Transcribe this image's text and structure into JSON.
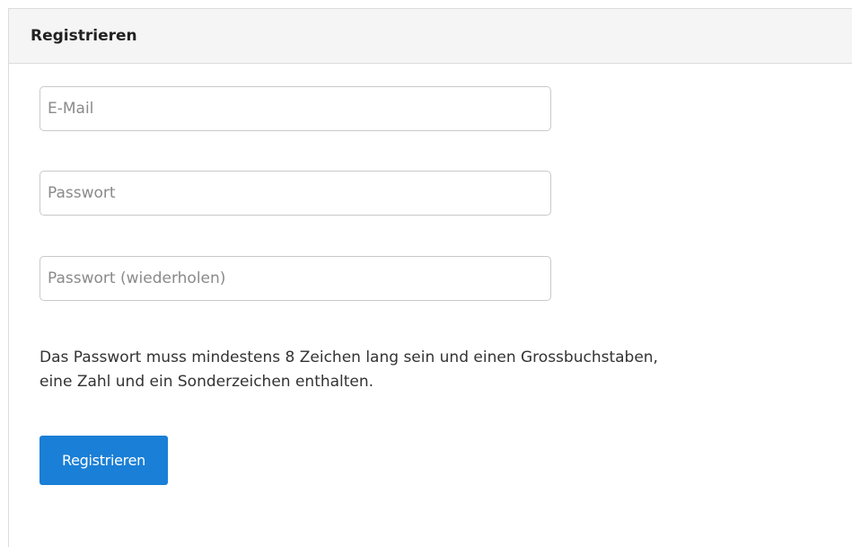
{
  "panel": {
    "title": "Registrieren"
  },
  "form": {
    "email": {
      "placeholder": "E-Mail",
      "value": ""
    },
    "password": {
      "placeholder": "Passwort",
      "value": ""
    },
    "password_repeat": {
      "placeholder": "Passwort (wiederholen)",
      "value": ""
    },
    "hint_line1": "Das Passwort muss mindestens 8 Zeichen lang sein und einen Grossbuchstaben,",
    "hint_line2": "eine Zahl und ein Sonderzeichen enthalten.",
    "submit_label": "Registrieren"
  },
  "colors": {
    "button": "#1a7fd6",
    "header_bg": "#f5f5f5",
    "border": "#dcdcdc"
  }
}
